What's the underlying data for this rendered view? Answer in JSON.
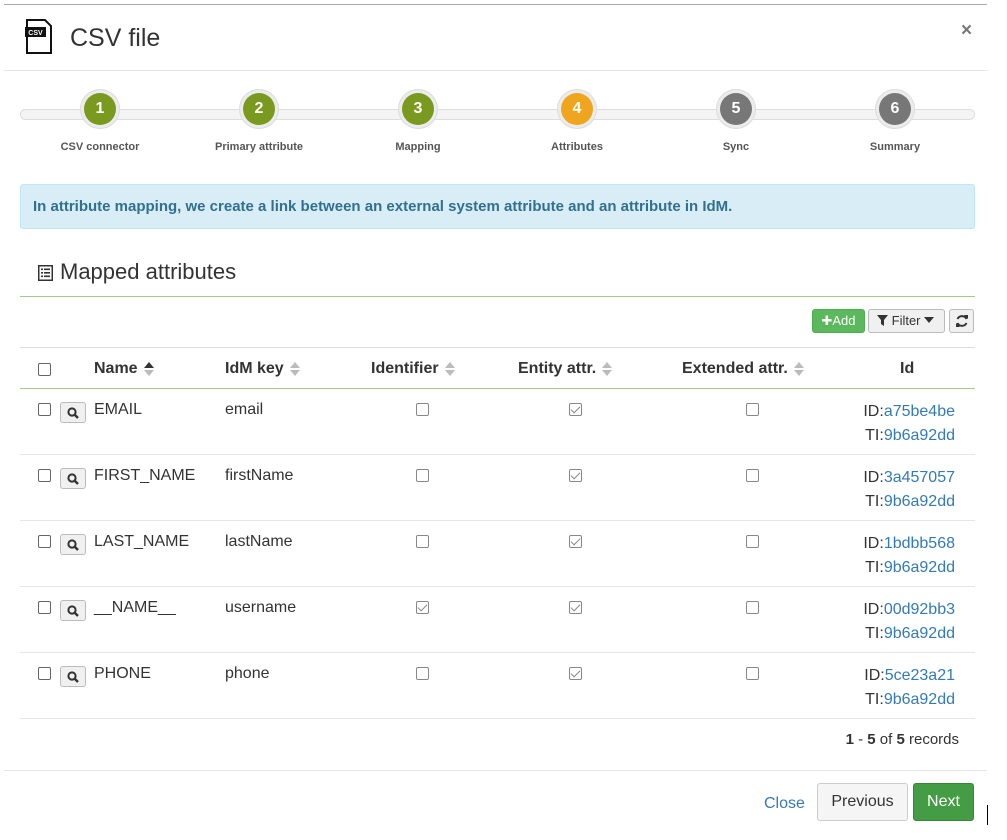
{
  "dialog": {
    "title": "CSV file",
    "icon_text": "CSV",
    "close_glyph": "×"
  },
  "wizard": {
    "steps": [
      {
        "number": "1",
        "label": "CSV connector",
        "state": "done"
      },
      {
        "number": "2",
        "label": "Primary attribute",
        "state": "done"
      },
      {
        "number": "3",
        "label": "Mapping",
        "state": "done"
      },
      {
        "number": "4",
        "label": "Attributes",
        "state": "active"
      },
      {
        "number": "5",
        "label": "Sync",
        "state": "todo"
      },
      {
        "number": "6",
        "label": "Summary",
        "state": "todo"
      }
    ]
  },
  "info": {
    "text": "In attribute mapping, we create a link between an external system attribute and an attribute in IdM."
  },
  "section": {
    "title": "Mapped attributes"
  },
  "toolbar": {
    "add_label": "Add",
    "filter_label": "Filter"
  },
  "table": {
    "columns": {
      "name": "Name",
      "idm_key": "IdM key",
      "identifier": "Identifier",
      "entity_attr": "Entity attr.",
      "extended_attr": "Extended attr.",
      "id": "Id"
    },
    "rows": [
      {
        "name": "EMAIL",
        "idm_key": "email",
        "identifier": false,
        "entity_attr": true,
        "extended_attr": false,
        "id_prefix": "ID:",
        "id": "a75be4be",
        "ti_prefix": "TI:",
        "ti": "9b6a92dd"
      },
      {
        "name": "FIRST_NAME",
        "idm_key": "firstName",
        "identifier": false,
        "entity_attr": true,
        "extended_attr": false,
        "id_prefix": "ID:",
        "id": "3a457057",
        "ti_prefix": "TI:",
        "ti": "9b6a92dd"
      },
      {
        "name": "LAST_NAME",
        "idm_key": "lastName",
        "identifier": false,
        "entity_attr": true,
        "extended_attr": false,
        "id_prefix": "ID:",
        "id": "1bdbb568",
        "ti_prefix": "TI:",
        "ti": "9b6a92dd"
      },
      {
        "name": "__NAME__",
        "idm_key": "username",
        "identifier": true,
        "entity_attr": true,
        "extended_attr": false,
        "id_prefix": "ID:",
        "id": "00d92bb3",
        "ti_prefix": "TI:",
        "ti": "9b6a92dd"
      },
      {
        "name": "PHONE",
        "idm_key": "phone",
        "identifier": false,
        "entity_attr": true,
        "extended_attr": false,
        "id_prefix": "ID:",
        "id": "5ce23a21",
        "ti_prefix": "TI:",
        "ti": "9b6a92dd"
      }
    ],
    "records": {
      "from": "1",
      "sep": " - ",
      "to": "5",
      "of": " of ",
      "total": "5",
      "suffix": " records"
    }
  },
  "footer": {
    "close_label": "Close",
    "previous_label": "Previous",
    "next_label": "Next"
  },
  "colors": {
    "step_done": "#7a9a1f",
    "step_active": "#f0a51e",
    "step_todo": "#777777",
    "info_bg": "#d9edf7",
    "info_text": "#31708f",
    "link": "#337ab7",
    "success": "#5cb85c"
  }
}
